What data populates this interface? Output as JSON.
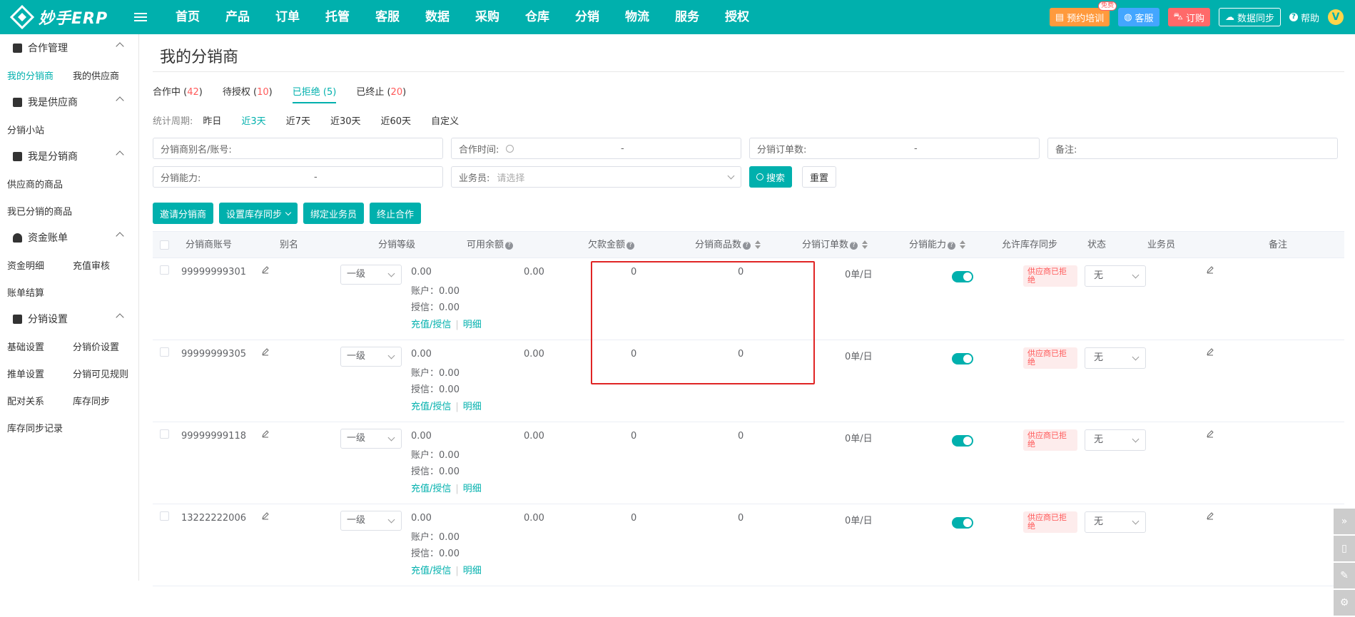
{
  "brand": {
    "name": "妙手ERP"
  },
  "nav": [
    {
      "label": "首页",
      "dot": false
    },
    {
      "label": "产品",
      "dot": false
    },
    {
      "label": "订单",
      "dot": true
    },
    {
      "label": "托管",
      "dot": false
    },
    {
      "label": "客服",
      "dot": true
    },
    {
      "label": "数据",
      "dot": false
    },
    {
      "label": "采购",
      "dot": false
    },
    {
      "label": "仓库",
      "dot": true
    },
    {
      "label": "分销",
      "dot": false
    },
    {
      "label": "物流",
      "dot": false
    },
    {
      "label": "服务",
      "dot": false
    },
    {
      "label": "授权",
      "dot": false
    }
  ],
  "topright": {
    "training": "预约培训",
    "free_badge": "免费",
    "service": "客服",
    "order": "订购",
    "sync": "数据同步",
    "help": "帮助",
    "avatar_letter": "V"
  },
  "sidebar": {
    "groups": [
      {
        "title": "合作管理",
        "links": [
          [
            "我的分销商",
            "我的供应商"
          ]
        ]
      },
      {
        "title": "我是供应商",
        "links": [
          [
            "分销小站"
          ]
        ]
      },
      {
        "title": "我是分销商",
        "links": [
          [
            "供应商的商品"
          ],
          [
            "我已分销的商品"
          ]
        ]
      },
      {
        "title": "资金账单",
        "links": [
          [
            "资金明细",
            "充值审核"
          ],
          [
            "账单结算"
          ]
        ]
      },
      {
        "title": "分销设置",
        "links": [
          [
            "基础设置",
            "分销价设置"
          ],
          [
            "推单设置",
            "分销可见规则"
          ],
          [
            "配对关系",
            "库存同步"
          ],
          [
            "库存同步记录"
          ]
        ]
      }
    ],
    "active": "我的分销商"
  },
  "page": {
    "title": "我的分销商",
    "tabs": [
      {
        "label": "合作中",
        "count": "42"
      },
      {
        "label": "待授权",
        "count": "10"
      },
      {
        "label": "已拒绝",
        "count": "5"
      },
      {
        "label": "已终止",
        "count": "20"
      }
    ],
    "active_tab": "已拒绝",
    "period": {
      "label": "统计周期:",
      "options": [
        "昨日",
        "近3天",
        "近7天",
        "近30天",
        "近60天",
        "自定义"
      ],
      "active": "近3天"
    },
    "filters": {
      "alias": "分销商别名/账号:",
      "coop_time": "合作时间:",
      "order_count": "分销订单数:",
      "remark": "备注:",
      "capacity": "分销能力:",
      "salesman": "业务员:",
      "salesman_placeholder": "请选择",
      "dash": "-",
      "search": "搜索",
      "reset": "重置"
    },
    "actions": {
      "invite": "邀请分销商",
      "stock_sync": "设置库存同步",
      "bind_sales": "绑定业务员",
      "terminate": "终止合作"
    }
  },
  "table": {
    "headers": {
      "account": "分销商账号",
      "alias": "别名",
      "level": "分销等级",
      "balance": "可用余额",
      "debt": "欠款金额",
      "products": "分销商品数",
      "orders": "分销订单数",
      "capacity": "分销能力",
      "allow_sync": "允许库存同步",
      "status": "状态",
      "salesman": "业务员",
      "remark": "备注"
    },
    "labels": {
      "account_prefix": "账户：",
      "credit_prefix": "授信：",
      "recharge": "充值/授信",
      "detail": "明细"
    },
    "rows": [
      {
        "account": "99999999301",
        "level": "一级",
        "balance": "0.00",
        "acct": "0.00",
        "credit": "0.00",
        "debt": "0.00",
        "products": "0",
        "orders": "0",
        "capacity": "0单/日",
        "status": "供应商已拒绝",
        "salesman": "无"
      },
      {
        "account": "99999999305",
        "level": "一级",
        "balance": "0.00",
        "acct": "0.00",
        "credit": "0.00",
        "debt": "0.00",
        "products": "0",
        "orders": "0",
        "capacity": "0单/日",
        "status": "供应商已拒绝",
        "salesman": "无"
      },
      {
        "account": "99999999118",
        "level": "一级",
        "balance": "0.00",
        "acct": "0.00",
        "credit": "0.00",
        "debt": "0.00",
        "products": "0",
        "orders": "0",
        "capacity": "0单/日",
        "status": "供应商已拒绝",
        "salesman": "无"
      },
      {
        "account": "13222222006",
        "level": "一级",
        "balance": "0.00",
        "acct": "0.00",
        "credit": "0.00",
        "debt": "0.00",
        "products": "0",
        "orders": "0",
        "capacity": "0单/日",
        "status": "供应商已拒绝",
        "salesman": "无"
      }
    ]
  },
  "colors": {
    "primary": "#00b0ad",
    "danger": "#ff5a5a",
    "highlight": "#e02424"
  },
  "icons": [
    "logo-icon",
    "menu-icon",
    "calendar-icon",
    "clock-icon",
    "search-icon",
    "pencil-icon",
    "question-icon",
    "sort-icon",
    "chevron-down-icon",
    "expand-icon",
    "mobile-icon",
    "feedback-icon",
    "settings-icon"
  ]
}
